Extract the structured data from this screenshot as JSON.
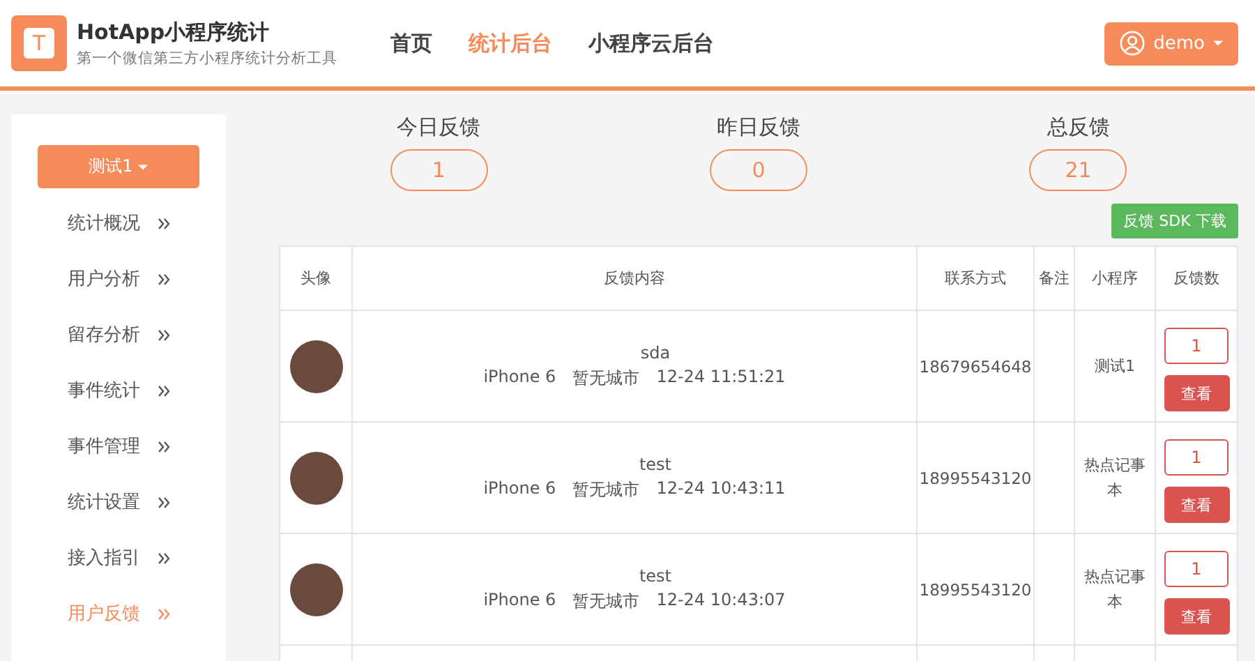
{
  "header": {
    "logo_letter": "T",
    "title": "HotApp小程序统计",
    "subtitle": "第一个微信第三方小程序统计分析工具",
    "nav": [
      {
        "label": "首页",
        "selected": false
      },
      {
        "label": "统计后台",
        "selected": true
      },
      {
        "label": "小程序云后台",
        "selected": false
      }
    ],
    "user": "demo"
  },
  "sidebar": {
    "app_button": "测试1",
    "items": [
      {
        "label": "统计概况",
        "selected": false
      },
      {
        "label": "用户分析",
        "selected": false
      },
      {
        "label": "留存分析",
        "selected": false
      },
      {
        "label": "事件统计",
        "selected": false
      },
      {
        "label": "事件管理",
        "selected": false
      },
      {
        "label": "统计设置",
        "selected": false
      },
      {
        "label": "接入指引",
        "selected": false
      },
      {
        "label": "用户反馈",
        "selected": true
      }
    ]
  },
  "stats": [
    {
      "label": "今日反馈",
      "value": "1"
    },
    {
      "label": "昨日反馈",
      "value": "0"
    },
    {
      "label": "总反馈",
      "value": "21"
    }
  ],
  "sdk_button": "反馈 SDK 下载",
  "table": {
    "columns": [
      "头像",
      "反馈内容",
      "联系方式",
      "备注",
      "小程序",
      "反馈数"
    ],
    "rows": [
      {
        "text": "sda",
        "device": "iPhone 6",
        "city": "暂无城市",
        "time": "12-24 11:51:21",
        "contact": "18679654648",
        "app": "测试1",
        "count": "1",
        "action": "查看"
      },
      {
        "text": "test",
        "device": "iPhone 6",
        "city": "暂无城市",
        "time": "12-24 10:43:11",
        "contact": "18995543120",
        "app": "热点记事本",
        "count": "1",
        "action": "查看"
      },
      {
        "text": "test",
        "device": "iPhone 6",
        "city": "暂无城市",
        "time": "12-24 10:43:07",
        "contact": "18995543120",
        "app": "热点记事本",
        "count": "1",
        "action": "查看"
      }
    ]
  }
}
